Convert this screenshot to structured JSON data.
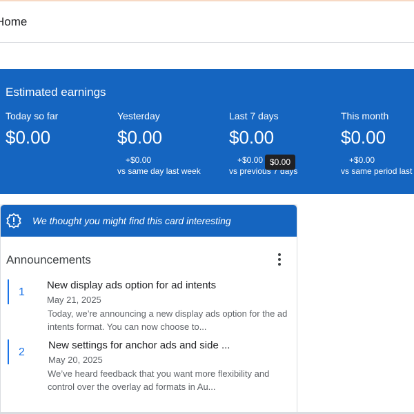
{
  "header": {
    "title": "Home"
  },
  "earnings": {
    "title": "Estimated earnings",
    "metrics": [
      {
        "label": "Today so far",
        "value": "$0.00",
        "change": "",
        "compare": ""
      },
      {
        "label": "Yesterday",
        "value": "$0.00",
        "change": "+$0.00",
        "compare": "vs same day last week"
      },
      {
        "label": "Last 7 days",
        "value": "$0.00",
        "change": "+$0.00",
        "compare": "vs previous 7 days"
      },
      {
        "label": "This month",
        "value": "$0.00",
        "change": "+$0.00",
        "compare": "vs same period last year"
      }
    ],
    "tooltip": "$0.00"
  },
  "card": {
    "banner": "We thought you might find this card interesting",
    "title": "Announcements",
    "items": [
      {
        "number": "1",
        "title": "New display ads option for ad intents",
        "date": "May 21, 2025",
        "description": "Today, we’re announcing a new display ads option for the ad intents format. You can now choose to..."
      },
      {
        "number": "2",
        "title": "New settings for anchor ads and side ...",
        "date": "May 20, 2025",
        "description": "We’ve heard feedback that you want more flexibility and control over the overlay ad formats in Au..."
      }
    ]
  },
  "colors": {
    "brand_blue": "#1565c0",
    "accent_blue": "#1a73e8"
  },
  "icons": {
    "banner": "lightbulb-badge-icon",
    "menu": "more-vert-icon"
  }
}
